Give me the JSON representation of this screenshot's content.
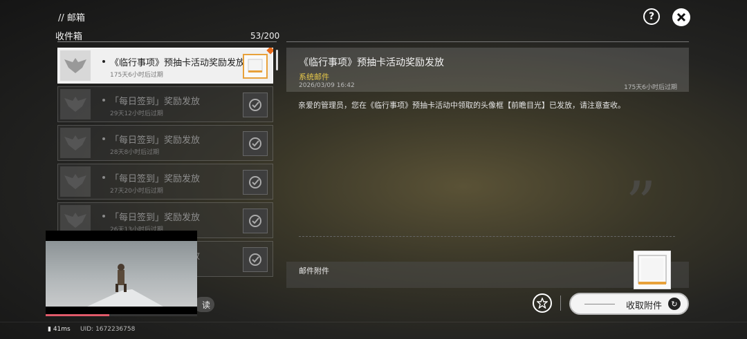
{
  "header": {
    "title": "// 邮箱"
  },
  "inbox": {
    "tab_label": "收件箱",
    "count": "53/200",
    "mails": [
      {
        "title": "《临行事项》预抽卡活动奖励发放",
        "subtitle": "175天6小时后过期",
        "status": "unread"
      },
      {
        "title": "「每日签到」奖励发放",
        "subtitle": "29天12小时后过期",
        "status": "claimed"
      },
      {
        "title": "「每日签到」奖励发放",
        "subtitle": "28天8小时后过期",
        "status": "claimed"
      },
      {
        "title": "「每日签到」奖励发放",
        "subtitle": "27天20小时后过期",
        "status": "claimed"
      },
      {
        "title": "「每日签到」奖励发放",
        "subtitle": "26天13小时后过期",
        "status": "claimed"
      },
      {
        "title": "「每日签到」奖励发放",
        "subtitle": "",
        "status": "claimed"
      }
    ]
  },
  "detail": {
    "title": "《临行事项》预抽卡活动奖励发放",
    "tag": "系统邮件",
    "date": "2026/03/09 16:42",
    "expire": "175天6小时后过期",
    "body": "亲爱的管理员，您在《临行事项》预抽卡活动中领取的头像框【前瞻目光】已发放，请注意查收。",
    "attachments_label": "邮件附件"
  },
  "actions": {
    "help": "?",
    "claim_label": "收取附件",
    "read_label": "读"
  },
  "video": {
    "progress": 0.42
  },
  "status": {
    "ping": "41ms",
    "uid": "UID: 1672236758"
  },
  "colors": {
    "accent_tag": "#e6c84a",
    "unread_marker": "#e86b1a",
    "video_progress": "#e05a6a"
  }
}
